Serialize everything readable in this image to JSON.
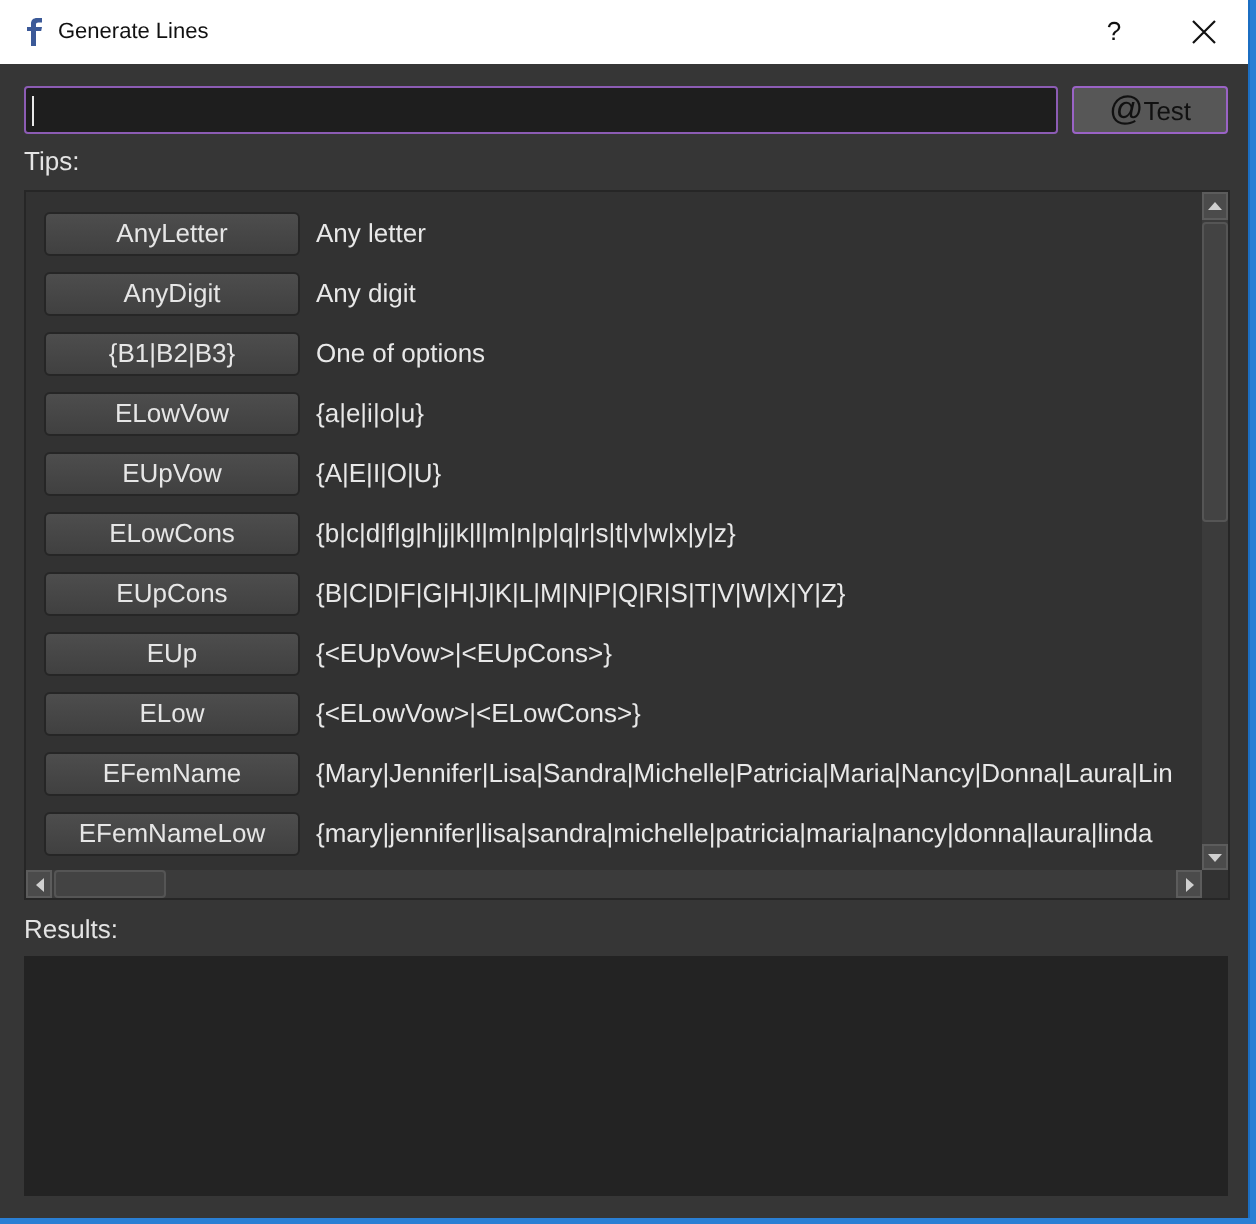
{
  "window": {
    "title": "Generate Lines",
    "help_button": "?"
  },
  "pattern_input": {
    "focused": true
  },
  "test_button": {
    "icon": "@",
    "label": "Test",
    "hovered": true
  },
  "tips": {
    "label": "Tips:",
    "rows": [
      {
        "button": "AnyLetter",
        "description": "Any letter"
      },
      {
        "button": "AnyDigit",
        "description": "Any digit"
      },
      {
        "button": "{B1|B2|B3}",
        "description": "One of options"
      },
      {
        "button": "ELowVow",
        "description": "{a|e|i|o|u}"
      },
      {
        "button": "EUpVow",
        "description": "{A|E|I|O|U}"
      },
      {
        "button": "ELowCons",
        "description": "{b|c|d|f|g|h|j|k|l|m|n|p|q|r|s|t|v|w|x|y|z}"
      },
      {
        "button": "EUpCons",
        "description": "{B|C|D|F|G|H|J|K|L|M|N|P|Q|R|S|T|V|W|X|Y|Z}"
      },
      {
        "button": "EUp",
        "description": "{<EUpVow>|<EUpCons>}"
      },
      {
        "button": "ELow",
        "description": "{<ELowVow>|<ELowCons>}"
      },
      {
        "button": "EFemName",
        "description": "{Mary|Jennifer|Lisa|Sandra|Michelle|Patricia|Maria|Nancy|Donna|Laura|Lin"
      },
      {
        "button": "EFemNameLow",
        "description": "{mary|jennifer|lisa|sandra|michelle|patricia|maria|nancy|donna|laura|linda"
      }
    ]
  },
  "results": {
    "label": "Results:"
  }
}
